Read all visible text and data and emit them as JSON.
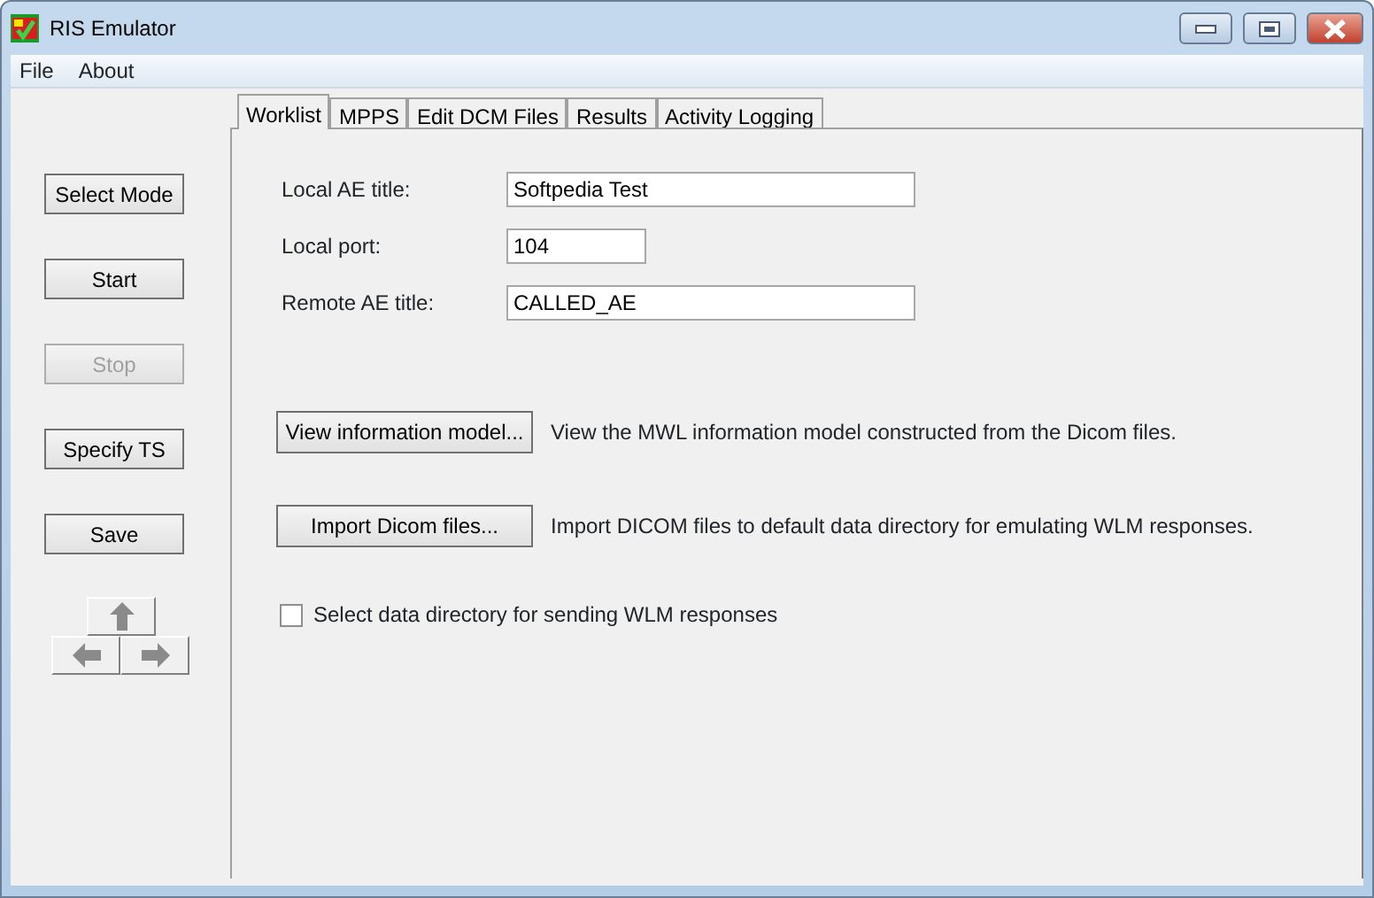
{
  "window": {
    "title": "RIS Emulator"
  },
  "menu": [
    "File",
    "About"
  ],
  "side_buttons": [
    {
      "label": "Select Mode",
      "disabled": false
    },
    {
      "label": "Start",
      "disabled": false
    },
    {
      "label": "Stop",
      "disabled": true
    },
    {
      "label": "Specify TS",
      "disabled": false
    },
    {
      "label": "Save",
      "disabled": false
    }
  ],
  "tabs": [
    {
      "label": "Worklist",
      "selected": true
    },
    {
      "label": "MPPS",
      "selected": false
    },
    {
      "label": "Edit DCM Files",
      "selected": false
    },
    {
      "label": "Results",
      "selected": false
    },
    {
      "label": "Activity Logging",
      "selected": false
    }
  ],
  "fields": [
    {
      "label": "Local AE title:",
      "value": "Softpedia Test",
      "kind": "wide"
    },
    {
      "label": "Local port:",
      "value": "104",
      "kind": "short"
    },
    {
      "label": "Remote AE title:",
      "value": "CALLED_AE",
      "kind": "wide"
    }
  ],
  "actions": [
    {
      "button": "View information model...",
      "description": "View the MWL information model constructed from the Dicom files."
    },
    {
      "button": "Import Dicom files...",
      "description": "Import DICOM files to default data directory for emulating WLM responses."
    }
  ],
  "checkbox": {
    "label": "Select data directory for sending WLM responses",
    "checked": false
  }
}
